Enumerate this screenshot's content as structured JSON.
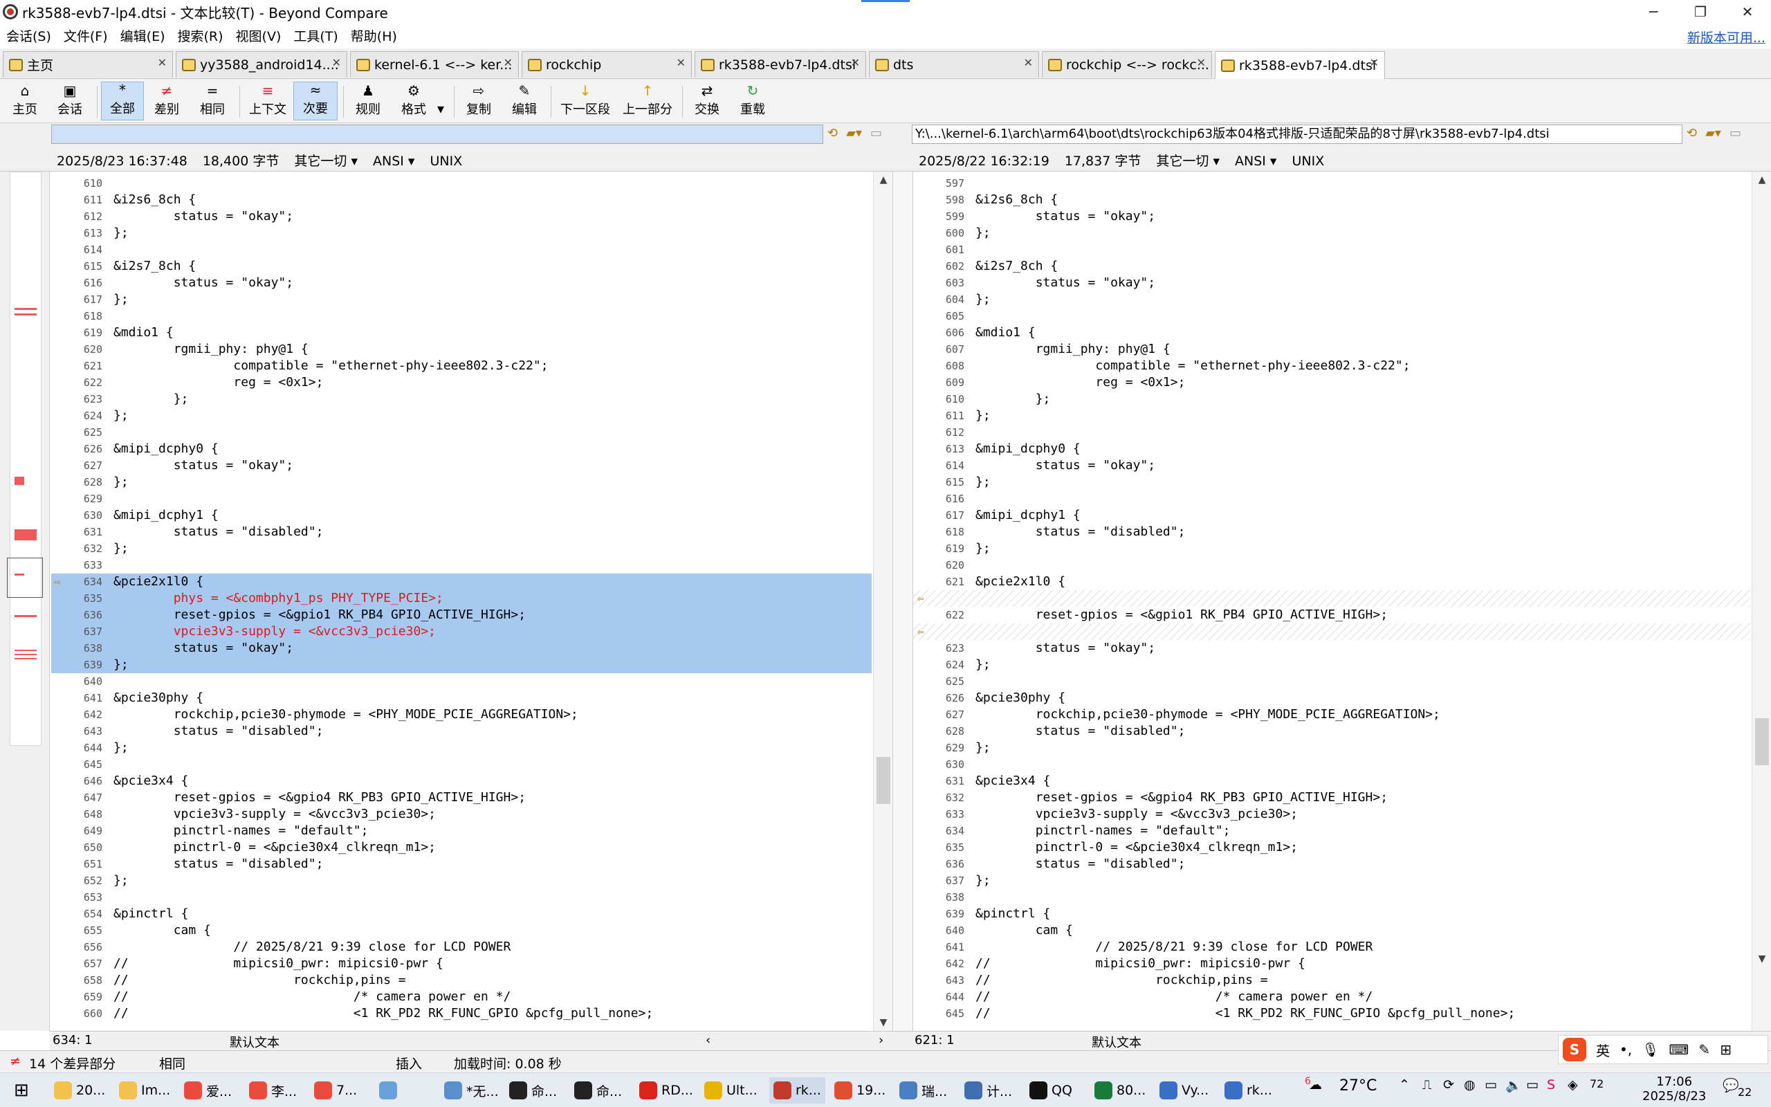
{
  "window": {
    "title": "rk3588-evb7-lp4.dtsi - 文本比较(T) - Beyond Compare",
    "controls": [
      "─",
      "❐",
      "✕"
    ]
  },
  "menu": {
    "items": [
      "会话(S)",
      "文件(F)",
      "编辑(E)",
      "搜索(R)",
      "视图(V)",
      "工具(T)",
      "帮助(H)"
    ],
    "new_version": "新版本可用..."
  },
  "tabs": [
    {
      "label": "主页"
    },
    {
      "label": "yy3588_android14...."
    },
    {
      "label": "kernel-6.1 <--> ker..."
    },
    {
      "label": "rockchip"
    },
    {
      "label": "rk3588-evb7-lp4.dtsi"
    },
    {
      "label": "dts"
    },
    {
      "label": "rockchip <--> rockc..."
    },
    {
      "label": "rk3588-evb7-lp4.dtsi"
    }
  ],
  "toolbar": {
    "home": "主页",
    "session": "会话",
    "all": "全部",
    "diffs": "差别",
    "same": "相同",
    "context": "上下文",
    "minor": "次要",
    "rules": "规则",
    "format": "格式",
    "copy": "复制",
    "edit": "编辑",
    "next_section": "下一区段",
    "prev_section": "上一部分",
    "swap": "交换",
    "reload": "重载"
  },
  "left": {
    "path": "",
    "date": "2025/8/23 16:37:48",
    "size": "18,400 字节",
    "filter": "其它一切",
    "encoding": "ANSI",
    "eol": "UNIX",
    "cursor": "634: 1",
    "text_type": "默认文本",
    "lines": [
      {
        "n": "610",
        "t": ""
      },
      {
        "n": "611",
        "t": "&i2s6_8ch {"
      },
      {
        "n": "612",
        "t": "        status = \"okay\";"
      },
      {
        "n": "613",
        "t": "};"
      },
      {
        "n": "614",
        "t": ""
      },
      {
        "n": "615",
        "t": "&i2s7_8ch {"
      },
      {
        "n": "616",
        "t": "        status = \"okay\";"
      },
      {
        "n": "617",
        "t": "};"
      },
      {
        "n": "618",
        "t": ""
      },
      {
        "n": "619",
        "t": "&mdio1 {"
      },
      {
        "n": "620",
        "t": "        rgmii_phy: phy@1 {"
      },
      {
        "n": "621",
        "t": "                compatible = \"ethernet-phy-ieee802.3-c22\";"
      },
      {
        "n": "622",
        "t": "                reg = <0x1>;"
      },
      {
        "n": "623",
        "t": "        };"
      },
      {
        "n": "624",
        "t": "};"
      },
      {
        "n": "625",
        "t": ""
      },
      {
        "n": "626",
        "t": "&mipi_dcphy0 {"
      },
      {
        "n": "627",
        "t": "        status = \"okay\";"
      },
      {
        "n": "628",
        "t": "};"
      },
      {
        "n": "629",
        "t": ""
      },
      {
        "n": "630",
        "t": "&mipi_dcphy1 {"
      },
      {
        "n": "631",
        "t": "        status = \"disabled\";"
      },
      {
        "n": "632",
        "t": "};"
      },
      {
        "n": "633",
        "t": ""
      },
      {
        "n": "634",
        "t": "&pcie2x1l0 {",
        "k": "sel"
      },
      {
        "n": "635",
        "t": "        phys = <&combphy1_ps PHY_TYPE_PCIE>;",
        "k": "sel red"
      },
      {
        "n": "636",
        "t": "        reset-gpios = <&gpio1 RK_PB4 GPIO_ACTIVE_HIGH>;",
        "k": "sel"
      },
      {
        "n": "637",
        "t": "        vpcie3v3-supply = <&vcc3v3_pcie30>;",
        "k": "sel red"
      },
      {
        "n": "638",
        "t": "        status = \"okay\";",
        "k": "sel"
      },
      {
        "n": "639",
        "t": "};",
        "k": "sel"
      },
      {
        "n": "640",
        "t": ""
      },
      {
        "n": "641",
        "t": "&pcie30phy {"
      },
      {
        "n": "642",
        "t": "        rockchip,pcie30-phymode = <PHY_MODE_PCIE_AGGREGATION>;"
      },
      {
        "n": "643",
        "t": "        status = \"disabled\";"
      },
      {
        "n": "644",
        "t": "};"
      },
      {
        "n": "645",
        "t": ""
      },
      {
        "n": "646",
        "t": "&pcie3x4 {"
      },
      {
        "n": "647",
        "t": "        reset-gpios = <&gpio4 RK_PB3 GPIO_ACTIVE_HIGH>;"
      },
      {
        "n": "648",
        "t": "        vpcie3v3-supply = <&vcc3v3_pcie30>;"
      },
      {
        "n": "649",
        "t": "        pinctrl-names = \"default\";"
      },
      {
        "n": "650",
        "t": "        pinctrl-0 = <&pcie30x4_clkreqn_m1>;"
      },
      {
        "n": "651",
        "t": "        status = \"disabled\";"
      },
      {
        "n": "652",
        "t": "};"
      },
      {
        "n": "653",
        "t": ""
      },
      {
        "n": "654",
        "t": "&pinctrl {"
      },
      {
        "n": "655",
        "t": "        cam {"
      },
      {
        "n": "656",
        "t": "                // 2025/8/21 9:39 close for LCD POWER"
      },
      {
        "n": "657",
        "t": "//              mipicsi0_pwr: mipicsi0-pwr {"
      },
      {
        "n": "658",
        "t": "//                      rockchip,pins ="
      },
      {
        "n": "659",
        "t": "//                              /* camera power en */"
      },
      {
        "n": "660",
        "t": "//                              <1 RK_PD2 RK_FUNC_GPIO &pcfg_pull_none>;"
      }
    ]
  },
  "right": {
    "path": "Y:\\...\\kernel-6.1\\arch\\arm64\\boot\\dts\\rockchip63版本04格式排版-只适配荣品的8寸屏\\rk3588-evb7-lp4.dtsi",
    "date": "2025/8/22 16:32:19",
    "size": "17,837 字节",
    "filter": "其它一切",
    "encoding": "ANSI",
    "eol": "UNIX",
    "cursor": "621: 1",
    "text_type": "默认文本",
    "lines": [
      {
        "n": "597",
        "t": ""
      },
      {
        "n": "598",
        "t": "&i2s6_8ch {"
      },
      {
        "n": "599",
        "t": "        status = \"okay\";"
      },
      {
        "n": "600",
        "t": "};"
      },
      {
        "n": "601",
        "t": ""
      },
      {
        "n": "602",
        "t": "&i2s7_8ch {"
      },
      {
        "n": "603",
        "t": "        status = \"okay\";"
      },
      {
        "n": "604",
        "t": "};"
      },
      {
        "n": "605",
        "t": ""
      },
      {
        "n": "606",
        "t": "&mdio1 {"
      },
      {
        "n": "607",
        "t": "        rgmii_phy: phy@1 {"
      },
      {
        "n": "608",
        "t": "                compatible = \"ethernet-phy-ieee802.3-c22\";"
      },
      {
        "n": "609",
        "t": "                reg = <0x1>;"
      },
      {
        "n": "610",
        "t": "        };"
      },
      {
        "n": "611",
        "t": "};"
      },
      {
        "n": "612",
        "t": ""
      },
      {
        "n": "613",
        "t": "&mipi_dcphy0 {"
      },
      {
        "n": "614",
        "t": "        status = \"okay\";"
      },
      {
        "n": "615",
        "t": "};"
      },
      {
        "n": "616",
        "t": ""
      },
      {
        "n": "617",
        "t": "&mipi_dcphy1 {"
      },
      {
        "n": "618",
        "t": "        status = \"disabled\";"
      },
      {
        "n": "619",
        "t": "};"
      },
      {
        "n": "620",
        "t": ""
      },
      {
        "n": "621",
        "t": "&pcie2x1l0 {",
        "k": "mark"
      },
      {
        "n": "",
        "t": "",
        "k": "gap",
        "a": "⇦"
      },
      {
        "n": "622",
        "t": "        reset-gpios = <&gpio1 RK_PB4 GPIO_ACTIVE_HIGH>;"
      },
      {
        "n": "",
        "t": "",
        "k": "gap",
        "a": "⇦"
      },
      {
        "n": "623",
        "t": "        status = \"okay\";"
      },
      {
        "n": "624",
        "t": "};"
      },
      {
        "n": "625",
        "t": ""
      },
      {
        "n": "626",
        "t": "&pcie30phy {"
      },
      {
        "n": "627",
        "t": "        rockchip,pcie30-phymode = <PHY_MODE_PCIE_AGGREGATION>;"
      },
      {
        "n": "628",
        "t": "        status = \"disabled\";"
      },
      {
        "n": "629",
        "t": "};"
      },
      {
        "n": "630",
        "t": ""
      },
      {
        "n": "631",
        "t": "&pcie3x4 {"
      },
      {
        "n": "632",
        "t": "        reset-gpios = <&gpio4 RK_PB3 GPIO_ACTIVE_HIGH>;"
      },
      {
        "n": "633",
        "t": "        vpcie3v3-supply = <&vcc3v3_pcie30>;"
      },
      {
        "n": "634",
        "t": "        pinctrl-names = \"default\";"
      },
      {
        "n": "635",
        "t": "        pinctrl-0 = <&pcie30x4_clkreqn_m1>;"
      },
      {
        "n": "636",
        "t": "        status = \"disabled\";"
      },
      {
        "n": "637",
        "t": "};"
      },
      {
        "n": "638",
        "t": ""
      },
      {
        "n": "639",
        "t": "&pinctrl {"
      },
      {
        "n": "640",
        "t": "        cam {"
      },
      {
        "n": "641",
        "t": "                // 2025/8/21 9:39 close for LCD POWER"
      },
      {
        "n": "642",
        "t": "//              mipicsi0_pwr: mipicsi0-pwr {"
      },
      {
        "n": "643",
        "t": "//                      rockchip,pins ="
      },
      {
        "n": "644",
        "t": "//                              /* camera power en */"
      },
      {
        "n": "645",
        "t": "//                              <1 RK_PD2 RK_FUNC_GPIO &pcfg_pull_none>;"
      }
    ]
  },
  "status": {
    "diff_count": "14 个差异部分",
    "same": "相同",
    "insert": "插入",
    "load_time": "加载时间: 0.08 秒"
  },
  "taskbar": {
    "items": [
      "20...",
      "Im...",
      "爱...",
      "李...",
      "7...",
      "",
      "*无...",
      "命...",
      "命...",
      "RD...",
      "Ult...",
      "rk...",
      "19...",
      "瑞...",
      "计...",
      "QQ",
      "80...",
      "Vy...",
      "rk..."
    ],
    "weather_badge": "6",
    "temperature": "27°C",
    "time": "17:06",
    "date": "2025/8/23",
    "notif_count": "22",
    "tray_badge": "72"
  },
  "ime": {
    "logo": "S",
    "lang": "英"
  },
  "colors": {
    "selection": "#a7c9ef",
    "diff_red": "#e01818",
    "accent": "#3b7ddd"
  }
}
